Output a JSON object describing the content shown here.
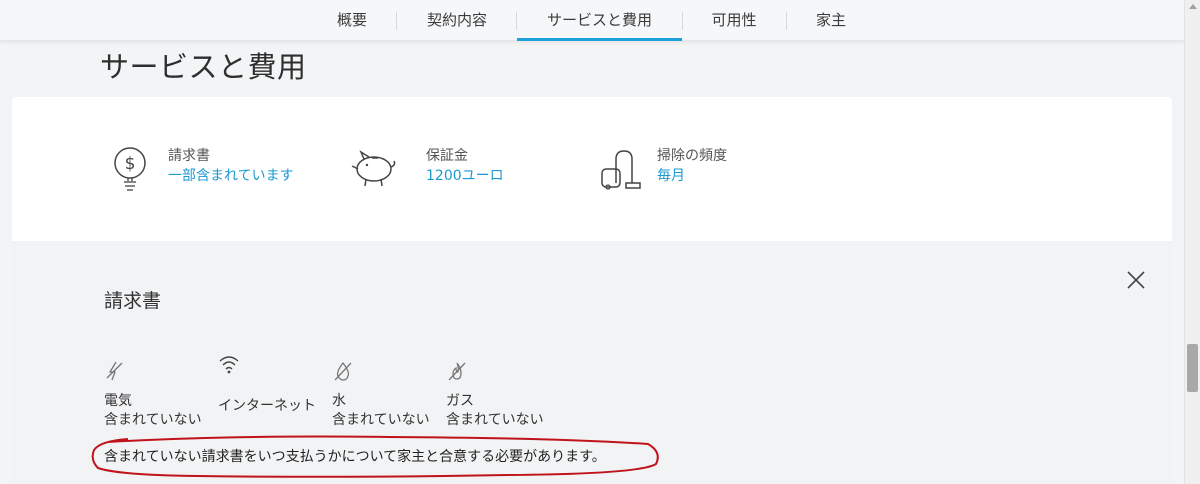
{
  "tabs": [
    {
      "label": "概要",
      "active": false
    },
    {
      "label": "契約内容",
      "active": false
    },
    {
      "label": "サービスと費用",
      "active": true
    },
    {
      "label": "可用性",
      "active": false
    },
    {
      "label": "家主",
      "active": false
    }
  ],
  "page_title": "サービスと費用",
  "fees": [
    {
      "icon": "dollar-bulb-icon",
      "label": "請求書",
      "value": "一部含まれています"
    },
    {
      "icon": "piggy-bank-icon",
      "label": "保証金",
      "value": "1200ユーロ"
    },
    {
      "icon": "vacuum-cleaner-icon",
      "label": "掃除の頻度",
      "value": "毎月"
    }
  ],
  "bills_panel": {
    "title": "請求書",
    "utilities": [
      {
        "icon": "electricity-crossed-icon",
        "name": "電気",
        "status": "含まれていない"
      },
      {
        "icon": "wifi-icon",
        "name": "インターネット",
        "status": ""
      },
      {
        "icon": "water-crossed-icon",
        "name": "水",
        "status": "含まれていない"
      },
      {
        "icon": "gas-crossed-icon",
        "name": "ガス",
        "status": "含まれていない"
      }
    ],
    "note": "含まれていない請求書をいつ支払うかについて家主と合意する必要があります。"
  },
  "colors": {
    "accent": "#1e9fd8",
    "value_text": "#1b9ad0",
    "annotation": "#c0141c"
  }
}
